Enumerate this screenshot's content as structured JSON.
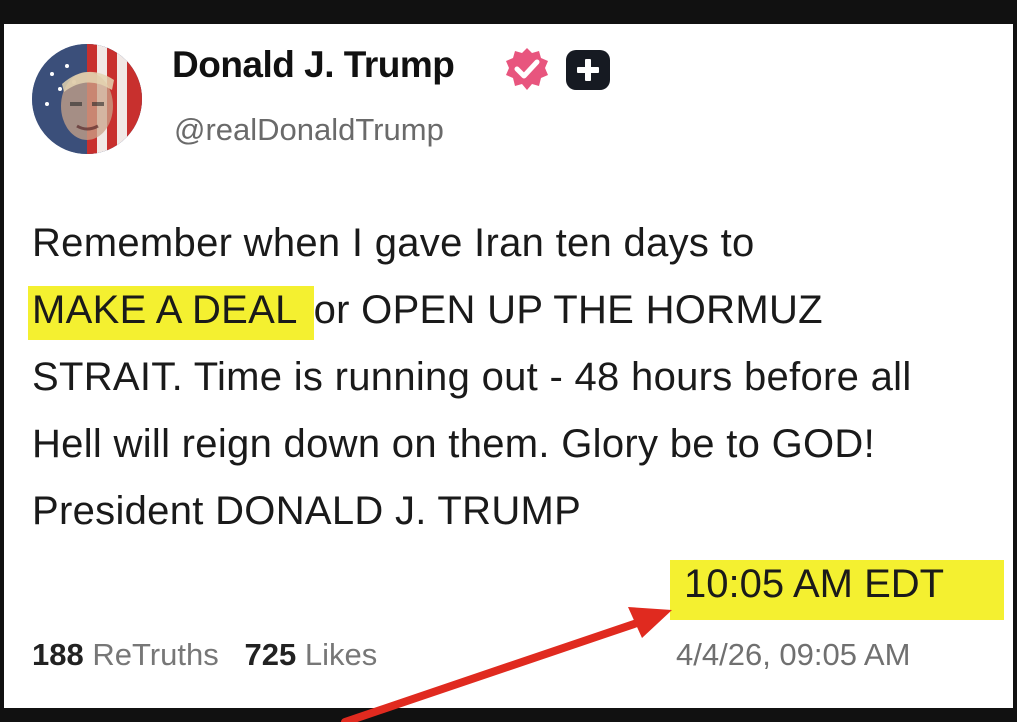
{
  "post": {
    "author_name": "Donald J. Trump",
    "author_handle": "@realDonaldTrump",
    "text_before_highlight": "Remember when I gave Iran ten days to",
    "highlight_text": "MAKE A DEAL ",
    "text_after_highlight": "or OPEN UP THE HORMUZ STRAIT. Time is running out - 48 hours before all Hell will reign down on them. Glory be to GOD! President DONALD J. TRUMP",
    "annotation_time": "10:05 AM EDT",
    "retruths_count": "188",
    "retruths_label": "ReTruths",
    "likes_count": "725",
    "likes_label": "Likes",
    "date": "4/4/26, 09:05 AM"
  },
  "icons": {
    "verified": "verified-badge-icon",
    "plus": "plus-badge-icon",
    "arrow": "red-arrow-annotation"
  },
  "colors": {
    "highlight": "#f4f030",
    "verified_badge": "#e8557e",
    "arrow": "#e02a1f"
  }
}
